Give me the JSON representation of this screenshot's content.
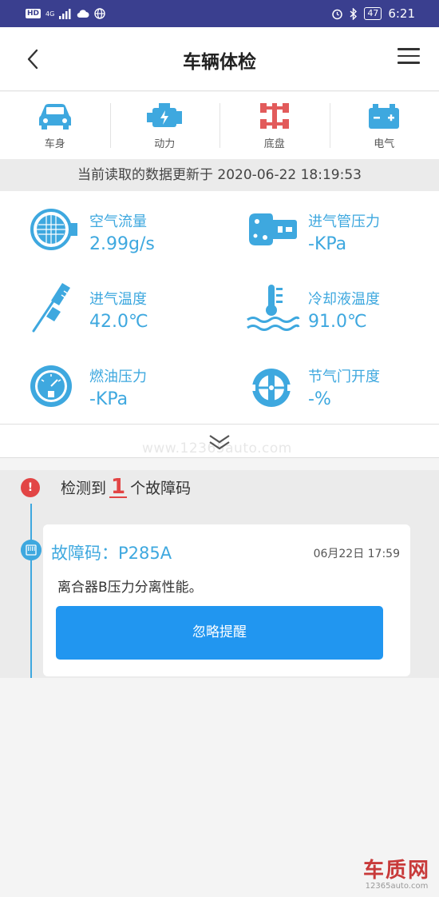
{
  "status_bar": {
    "hd": "HD",
    "signal": "4G",
    "time": "6:21",
    "battery": "47"
  },
  "header": {
    "title": "车辆体检"
  },
  "tabs": [
    {
      "label": "车身",
      "icon": "car-body-icon"
    },
    {
      "label": "动力",
      "icon": "engine-icon"
    },
    {
      "label": "底盘",
      "icon": "chassis-icon"
    },
    {
      "label": "电气",
      "icon": "battery-icon"
    }
  ],
  "update_text": "当前读取的数据更新于 2020-06-22 18:19:53",
  "sensors": [
    {
      "label": "空气流量",
      "value": "2.99g/s",
      "icon": "air-flow-icon"
    },
    {
      "label": "进气管压力",
      "value": "-KPa",
      "icon": "intake-pressure-icon"
    },
    {
      "label": "进气温度",
      "value": "42.0℃",
      "icon": "intake-temp-icon"
    },
    {
      "label": "冷却液温度",
      "value": "91.0℃",
      "icon": "coolant-temp-icon"
    },
    {
      "label": "燃油压力",
      "value": "-KPa",
      "icon": "fuel-pressure-icon"
    },
    {
      "label": "节气门开度",
      "value": "-%",
      "icon": "throttle-icon"
    }
  ],
  "watermark": "www.12365auto.com",
  "fault": {
    "prefix": "检测到",
    "count": "1",
    "suffix": "个故障码",
    "code_title": "故障码：P285A",
    "time": "06月22日 17:59",
    "description": "离合器B压力分离性能。",
    "ignore_button": "忽略提醒"
  },
  "footer": {
    "brand": "车质网",
    "url": "12365auto.com"
  },
  "colors": {
    "accent": "#3ea8df",
    "button": "#2196f0",
    "alert": "#e24545",
    "statusbar": "#3a3f8f"
  }
}
